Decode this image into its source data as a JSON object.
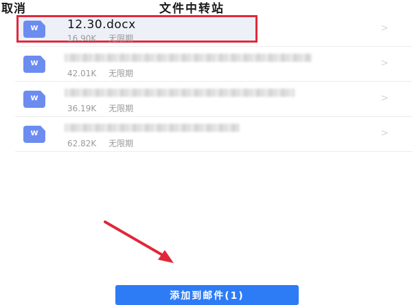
{
  "header": {
    "cancel_label": "取消",
    "title": "文件中转站"
  },
  "files": [
    {
      "name": "12.30.docx",
      "size": "16.90K",
      "expiry": "无限期",
      "icon": "word-doc-icon",
      "selected": true
    },
    {
      "name": "",
      "size": "42.01K",
      "expiry": "无限期",
      "icon": "word-doc-icon",
      "name_blurred": true
    },
    {
      "name": "",
      "size": "36.19K",
      "expiry": "无限期",
      "icon": "word-doc-icon",
      "name_blurred": true
    },
    {
      "name": "",
      "size": "62.82K",
      "expiry": "无限期",
      "icon": "word-doc-icon",
      "name_blurred": true
    }
  ],
  "icon_letter": "W",
  "chevron": ">",
  "add_button": {
    "label": "添加到邮件(1)"
  },
  "colors": {
    "accent": "#2d7cf6",
    "doc_icon": "#6c8cf0",
    "highlight_border": "#e0283a",
    "annotation_arrow": "#e0283a"
  }
}
